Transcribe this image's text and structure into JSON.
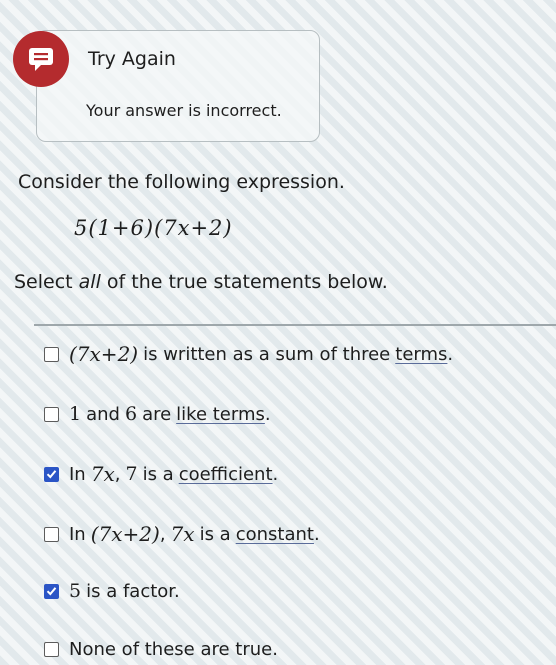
{
  "feedback": {
    "title": "Try Again",
    "message": "Your answer is incorrect.",
    "icon": "chat-bubble-icon",
    "accent_color": "#b42b2e"
  },
  "question": {
    "prompt": "Consider the following expression.",
    "expression": "5(1+6)(7x+2)",
    "instruction_before": "Select ",
    "instruction_emphasis": "all",
    "instruction_after": " of the true statements below."
  },
  "options": [
    {
      "parts": [
        "(7x+2)",
        "is written as a sum of three",
        "terms",
        "."
      ],
      "checked": false
    },
    {
      "parts": [
        "1",
        "and",
        "6",
        "are",
        "like terms",
        "."
      ],
      "checked": false
    },
    {
      "parts": [
        "In",
        "7x",
        ",",
        "7",
        "is a",
        "coefficient",
        "."
      ],
      "checked": true
    },
    {
      "parts": [
        "In",
        "(7x+2)",
        ",",
        "7x",
        "is a",
        "constant",
        "."
      ],
      "checked": false
    },
    {
      "parts": [
        "5",
        "is a factor."
      ],
      "checked": true
    },
    {
      "parts": [
        "None of these are true."
      ],
      "checked": false
    }
  ],
  "colors": {
    "checkbox_checked": "#2b55c6"
  }
}
